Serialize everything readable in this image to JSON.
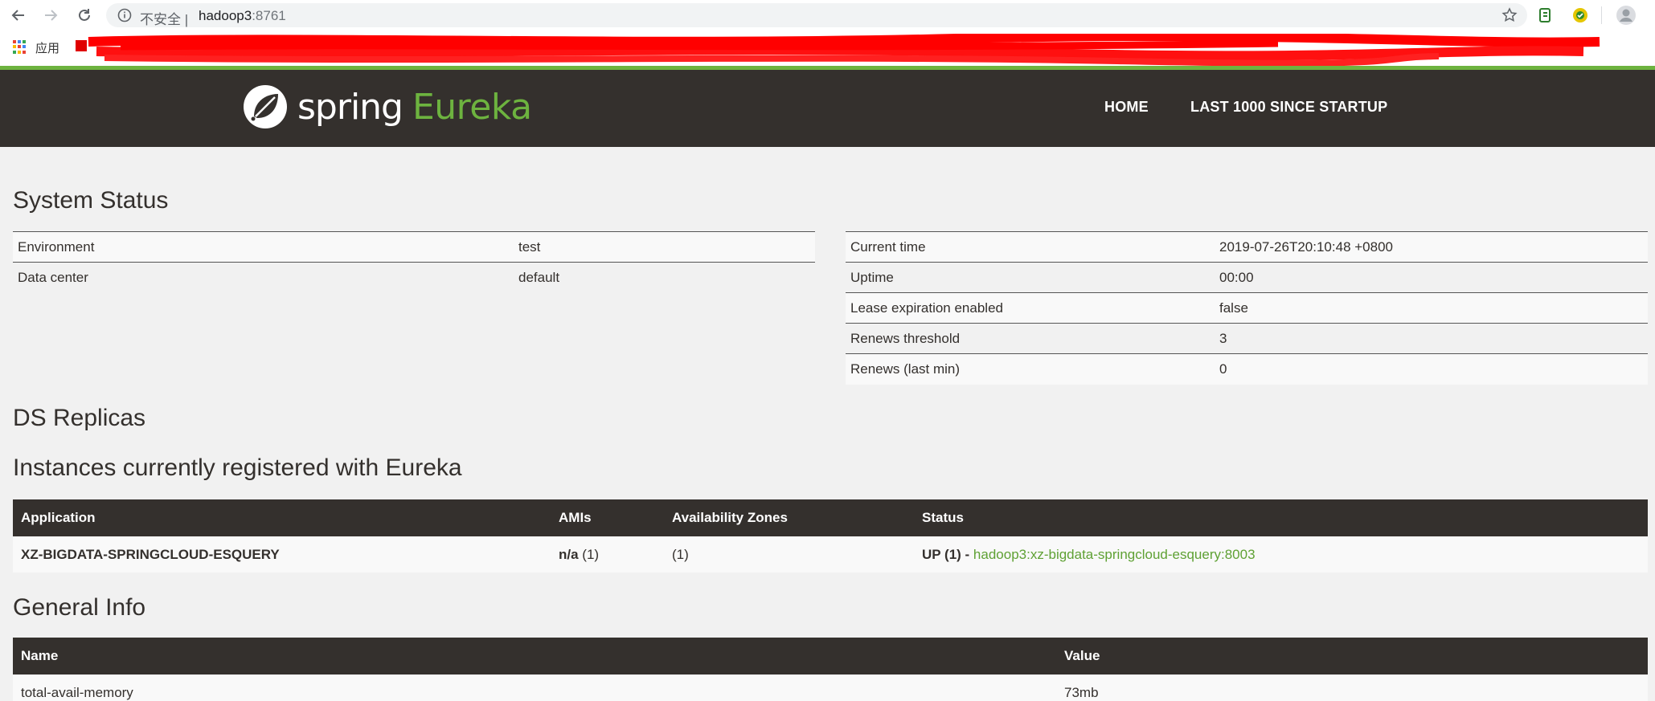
{
  "browser": {
    "security_label": "不安全 |",
    "url_host": "hadoop3",
    "url_port": ":8761",
    "apps_label": "应用"
  },
  "header": {
    "logo_spring": "spring",
    "logo_eureka": "Eureka",
    "nav_home": "HOME",
    "nav_last": "LAST 1000 SINCE STARTUP",
    "bg_color": "#34302d",
    "accent_color": "#6db33f"
  },
  "system_status": {
    "title": "System Status",
    "left": [
      {
        "label": "Environment",
        "value": "test"
      },
      {
        "label": "Data center",
        "value": "default"
      }
    ],
    "right": [
      {
        "label": "Current time",
        "value": "2019-07-26T20:10:48 +0800"
      },
      {
        "label": "Uptime",
        "value": "00:00"
      },
      {
        "label": "Lease expiration enabled",
        "value": "false"
      },
      {
        "label": "Renews threshold",
        "value": "3"
      },
      {
        "label": "Renews (last min)",
        "value": "0"
      }
    ]
  },
  "ds_replicas": {
    "title": "DS Replicas"
  },
  "instances": {
    "title": "Instances currently registered with Eureka",
    "columns": [
      "Application",
      "AMIs",
      "Availability Zones",
      "Status"
    ],
    "rows": [
      {
        "application": "XZ-BIGDATA-SPRINGCLOUD-ESQUERY",
        "amis_bold": "n/a",
        "amis_count": " (1)",
        "zones": "(1)",
        "status_prefix": "UP (1) - ",
        "status_link": "hadoop3:xz-bigdata-springcloud-esquery:8003"
      }
    ]
  },
  "general_info": {
    "title": "General Info",
    "columns": [
      "Name",
      "Value"
    ],
    "rows": [
      {
        "name": "total-avail-memory",
        "value": "73mb"
      }
    ]
  }
}
